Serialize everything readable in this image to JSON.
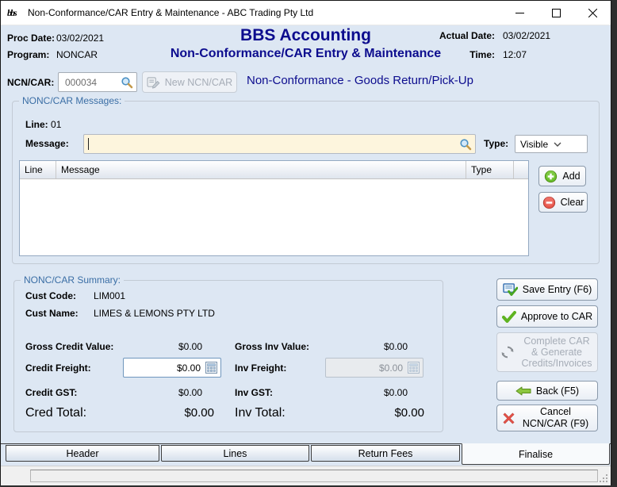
{
  "window": {
    "title": "Non-Conformance/CAR Entry & Maintenance - ABC Trading Pty Ltd",
    "logo_text": "bbs"
  },
  "header": {
    "proc_date_label": "Proc Date:",
    "proc_date": "03/02/2021",
    "program_label": "Program:",
    "program": "NONCAR",
    "app_title": "BBS Accounting",
    "screen_title": "Non-Conformance/CAR Entry & Maintenance",
    "actual_date_label": "Actual Date:",
    "actual_date": "03/02/2021",
    "time_label": "Time:",
    "time": "12:07"
  },
  "ncn_bar": {
    "label": "NCN/CAR:",
    "number": "000034",
    "new_button_label": "New NCN/CAR",
    "status_text": "Non-Conformance - Goods Return/Pick-Up"
  },
  "messages": {
    "group_title": "NONC/CAR Messages:",
    "line_label": "Line:",
    "line_value": "01",
    "message_label": "Message:",
    "message_value": "",
    "type_label": "Type:",
    "type_value": "Visible",
    "table": {
      "columns": [
        "Line",
        "Message",
        "Type"
      ],
      "rows": []
    },
    "add_label": "Add",
    "clear_label": "Clear"
  },
  "summary": {
    "group_title": "NONC/CAR Summary:",
    "cust_code_label": "Cust Code:",
    "cust_code": "LIM001",
    "cust_name_label": "Cust Name:",
    "cust_name": "LIMES & LEMONS PTY LTD",
    "gross_credit_label": "Gross Credit Value:",
    "gross_credit_value": "$0.00",
    "credit_freight_label": "Credit Freight:",
    "credit_freight_value": "$0.00",
    "credit_gst_label": "Credit GST:",
    "credit_gst_value": "$0.00",
    "cred_total_label": "Cred Total:",
    "cred_total_value": "$0.00",
    "gross_inv_label": "Gross Inv Value:",
    "gross_inv_value": "$0.00",
    "inv_freight_label": "Inv Freight:",
    "inv_freight_value": "$0.00",
    "inv_gst_label": "Inv GST:",
    "inv_gst_value": "$0.00",
    "inv_total_label": "Inv Total:",
    "inv_total_value": "$0.00"
  },
  "actions": {
    "save": "Save Entry (F6)",
    "approve": "Approve to CAR",
    "complete": "Complete CAR & Generate Credits/Invoices",
    "back": "Back (F5)",
    "cancel": "Cancel NCN/CAR (F9)"
  },
  "tabs": [
    {
      "label": "Header"
    },
    {
      "label": "Lines"
    },
    {
      "label": "Return Fees"
    },
    {
      "label": "Finalise"
    }
  ],
  "colors": {
    "navy_text": "#0c0c8e",
    "legend_blue": "#3a6ea5",
    "window_bg": "#dde7f3",
    "message_input_bg": "#fdf5dd",
    "add_green": "#6abf2e",
    "clear_red": "#e9594f"
  }
}
